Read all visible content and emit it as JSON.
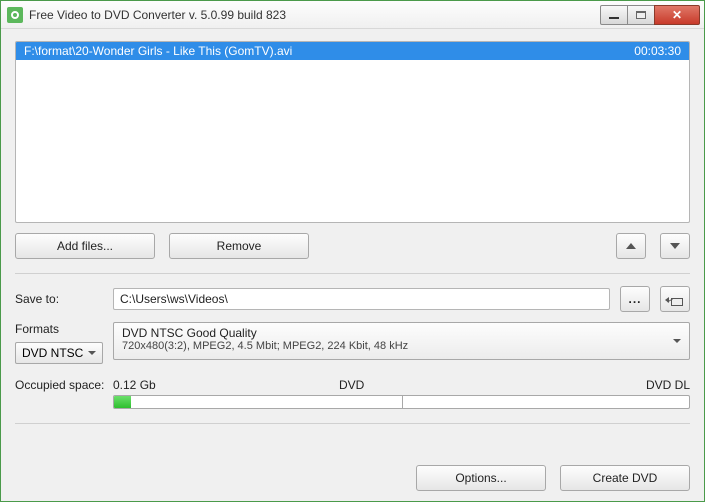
{
  "window": {
    "title": "Free Video to DVD Converter  v. 5.0.99 build 823"
  },
  "filelist": {
    "items": [
      {
        "path": "F:\\format\\20-Wonder Girls - Like This (GomTV).avi",
        "duration": "00:03:30"
      }
    ]
  },
  "buttons": {
    "add_files": "Add files...",
    "remove": "Remove",
    "browse": "...",
    "options": "Options...",
    "create_dvd": "Create DVD"
  },
  "save": {
    "label": "Save to:",
    "path": "C:\\Users\\ws\\Videos\\"
  },
  "formats": {
    "label": "Formats",
    "selected": "DVD NTSC",
    "detail_line1": "DVD NTSC Good Quality",
    "detail_line2": "720x480(3:2), MPEG2, 4.5 Mbit; MPEG2, 224 Kbit, 48 kHz"
  },
  "space": {
    "label": "Occupied space:",
    "value": "0.12 Gb",
    "marker_dvd": "DVD",
    "marker_dvddl": "DVD DL",
    "percent": 3
  }
}
